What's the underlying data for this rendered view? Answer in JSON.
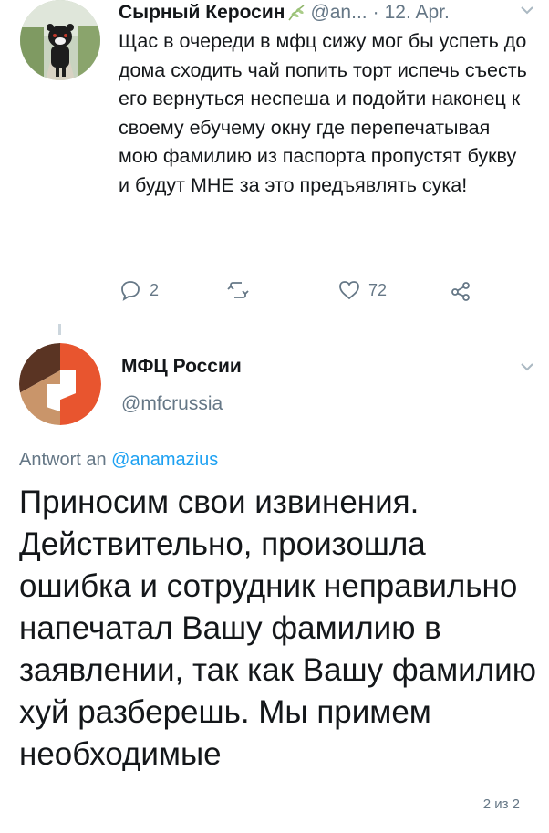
{
  "tweet1": {
    "author_name": "Сырный Керосин",
    "handle": "@an...",
    "date": "12. Apr.",
    "text": "Щас в очереди в мфц сижу мог бы успеть до дома сходить чай попить торт испечь съесть его вернуться неспеша и подойти наконец к своему ебучему окну где перепечатывая мою фамилию из паспорта пропустят букву и будут МНЕ за это предъявлять сука!",
    "reply_count": "2",
    "retweet_count": "",
    "like_count": "72"
  },
  "tweet2": {
    "author_name": "МФЦ России",
    "handle": "@mfcrussia",
    "reply_prefix": "Antwort an ",
    "reply_to": "@anamazius",
    "text": "Приносим свои извинения. Действительно, произошла ошибка и сотрудник неправильно напечатал Вашу фамилию в заявлении, так как Вашу фамилию хуй разберешь. Мы примем необходимые",
    "pager": "2 из 2"
  },
  "colors": {
    "text": "#14171a",
    "secondary": "#657786",
    "link": "#1da1f2",
    "logo_orange": "#e8552f",
    "logo_brown": "#5a3423",
    "logo_tan": "#c9956a"
  }
}
